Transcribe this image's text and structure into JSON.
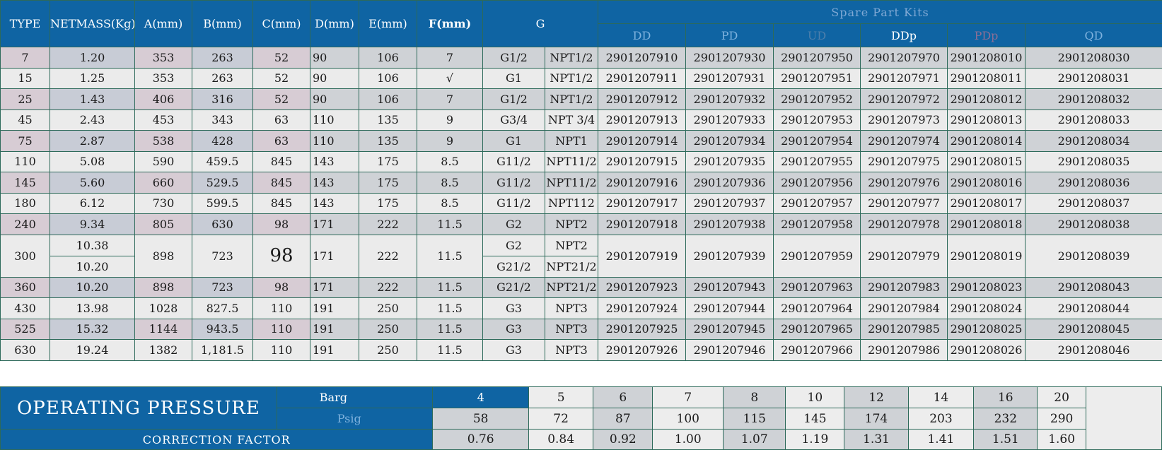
{
  "header": {
    "type": "TYPE",
    "netmass": "NETMASS(Kg)",
    "a": "A(mm)",
    "b": "B(mm)",
    "c": "C(mm)",
    "d": "D(mm)",
    "e": "E(mm)",
    "f": "F(mm)",
    "g": "G",
    "spare_part_kits": "Spare Part Kits",
    "kits": [
      "DD",
      "PD",
      "UD",
      "DDp",
      "PDp",
      "QD"
    ]
  },
  "rows": [
    {
      "type": "7",
      "mass": "1.20",
      "a": "353",
      "b": "263",
      "c": "52",
      "d": "90",
      "e": "106",
      "f": "7",
      "g1": "G1/2",
      "g2": "NPT1/2",
      "kits": [
        "2901207910",
        "2901207930",
        "2901207950",
        "2901207970",
        "2901208010",
        "2901208030"
      ]
    },
    {
      "type": "15",
      "mass": "1.25",
      "a": "353",
      "b": "263",
      "c": "52",
      "d": "90",
      "e": "106",
      "f": "√",
      "g1": "G1",
      "g2": "NPT1/2",
      "kits": [
        "2901207911",
        "2901207931",
        "2901207951",
        "2901207971",
        "2901208011",
        "2901208031"
      ]
    },
    {
      "type": "25",
      "mass": "1.43",
      "a": "406",
      "b": "316",
      "c": "52",
      "d": "90",
      "e": "106",
      "f": "7",
      "g1": "G1/2",
      "g2": "NPT1/2",
      "kits": [
        "2901207912",
        "2901207932",
        "2901207952",
        "2901207972",
        "2901208012",
        "2901208032"
      ]
    },
    {
      "type": "45",
      "mass": "2.43",
      "a": "453",
      "b": "343",
      "c": "63",
      "d": "110",
      "e": "135",
      "f": "9",
      "g1": "G3/4",
      "g2": "NPT 3/4",
      "kits": [
        "2901207913",
        "2901207933",
        "2901207953",
        "2901207973",
        "2901208013",
        "2901208033"
      ]
    },
    {
      "type": "75",
      "mass": "2.87",
      "a": "538",
      "b": "428",
      "c": "63",
      "d": "110",
      "e": "135",
      "f": "9",
      "g1": "G1",
      "g2": "NPT1",
      "kits": [
        "2901207914",
        "2901207934",
        "2901207954",
        "2901207974",
        "2901208014",
        "2901208034"
      ]
    },
    {
      "type": "110",
      "mass": "5.08",
      "a": "590",
      "b": "459.5",
      "c": "845",
      "d": "143",
      "e": "175",
      "f": "8.5",
      "g1": "G11/2",
      "g2": "NPT11/2",
      "kits": [
        "2901207915",
        "2901207935",
        "2901207955",
        "2901207975",
        "2901208015",
        "2901208035"
      ]
    },
    {
      "type": "145",
      "mass": "5.60",
      "a": "660",
      "b": "529.5",
      "c": "845",
      "d": "143",
      "e": "175",
      "f": "8.5",
      "g1": "G11/2",
      "g2": "NPT11/2",
      "kits": [
        "2901207916",
        "2901207936",
        "2901207956",
        "2901207976",
        "2901208016",
        "2901208036"
      ]
    },
    {
      "type": "180",
      "mass": "6.12",
      "a": "730",
      "b": "599.5",
      "c": "845",
      "d": "143",
      "e": "175",
      "f": "8.5",
      "g1": "G11/2",
      "g2": "NPT112",
      "kits": [
        "2901207917",
        "2901207937",
        "2901207957",
        "2901207977",
        "2901208017",
        "2901208037"
      ]
    },
    {
      "type": "240",
      "mass": "9.34",
      "a": "805",
      "b": "630",
      "c": "98",
      "d": "171",
      "e": "222",
      "f": "11.5",
      "g1": "G2",
      "g2": "NPT2",
      "kits": [
        "2901207918",
        "2901207938",
        "2901207958",
        "2901207978",
        "2901208018",
        "2901208038"
      ]
    }
  ],
  "row300": {
    "type": "300",
    "mass1": "10.38",
    "mass2": "10.20",
    "a": "898",
    "b": "723",
    "c": "98",
    "d": "171",
    "e": "222",
    "f": "11.5",
    "g1a": "G2",
    "g2a": "NPT2",
    "g1b": "G21/2",
    "g2b": "NPT21/2",
    "kits": [
      "2901207919",
      "2901207939",
      "2901207959",
      "2901207979",
      "2901208019",
      "2901208039"
    ]
  },
  "rows2": [
    {
      "type": "360",
      "mass": "10.20",
      "a": "898",
      "b": "723",
      "c": "98",
      "d": "171",
      "e": "222",
      "f": "11.5",
      "g1": "G21/2",
      "g2": "NPT21/2",
      "kits": [
        "2901207923",
        "2901207943",
        "2901207963",
        "2901207983",
        "2901208023",
        "2901208043"
      ]
    },
    {
      "type": "430",
      "mass": "13.98",
      "a": "1028",
      "b": "827.5",
      "c": "110",
      "d": "191",
      "e": "250",
      "f": "11.5",
      "g1": "G3",
      "g2": "NPT3",
      "kits": [
        "2901207924",
        "2901207944",
        "2901207964",
        "2901207984",
        "2901208024",
        "2901208044"
      ]
    },
    {
      "type": "525",
      "mass": "15.32",
      "a": "1144",
      "b": "943.5",
      "c": "110",
      "d": "191",
      "e": "250",
      "f": "11.5",
      "g1": "G3",
      "g2": "NPT3",
      "kits": [
        "2901207925",
        "2901207945",
        "2901207965",
        "2901207985",
        "2901208025",
        "2901208045"
      ]
    },
    {
      "type": "630",
      "mass": "19.24",
      "a": "1382",
      "b": "1,181.5",
      "c": "110",
      "d": "191",
      "e": "250",
      "f": "11.5",
      "g1": "G3",
      "g2": "NPT3",
      "kits": [
        "2901207926",
        "2901207946",
        "2901207966",
        "2901207986",
        "2901208026",
        "2901208046"
      ]
    }
  ],
  "pressure": {
    "operating_label": "OPERATING PRESSURE",
    "barg_label": "Barg",
    "psig_label": "Psig",
    "correction_label": "CORRECTION FACTOR",
    "barg": [
      "4",
      "5",
      "6",
      "7",
      "8",
      "10",
      "12",
      "14",
      "16",
      "20"
    ],
    "psig": [
      "58",
      "72",
      "87",
      "100",
      "115",
      "145",
      "174",
      "203",
      "232",
      "290"
    ],
    "factor": [
      "0.76",
      "0.84",
      "0.92",
      "1.00",
      "1.07",
      "1.19",
      "1.31",
      "1.41",
      "1.51",
      "1.60"
    ]
  }
}
